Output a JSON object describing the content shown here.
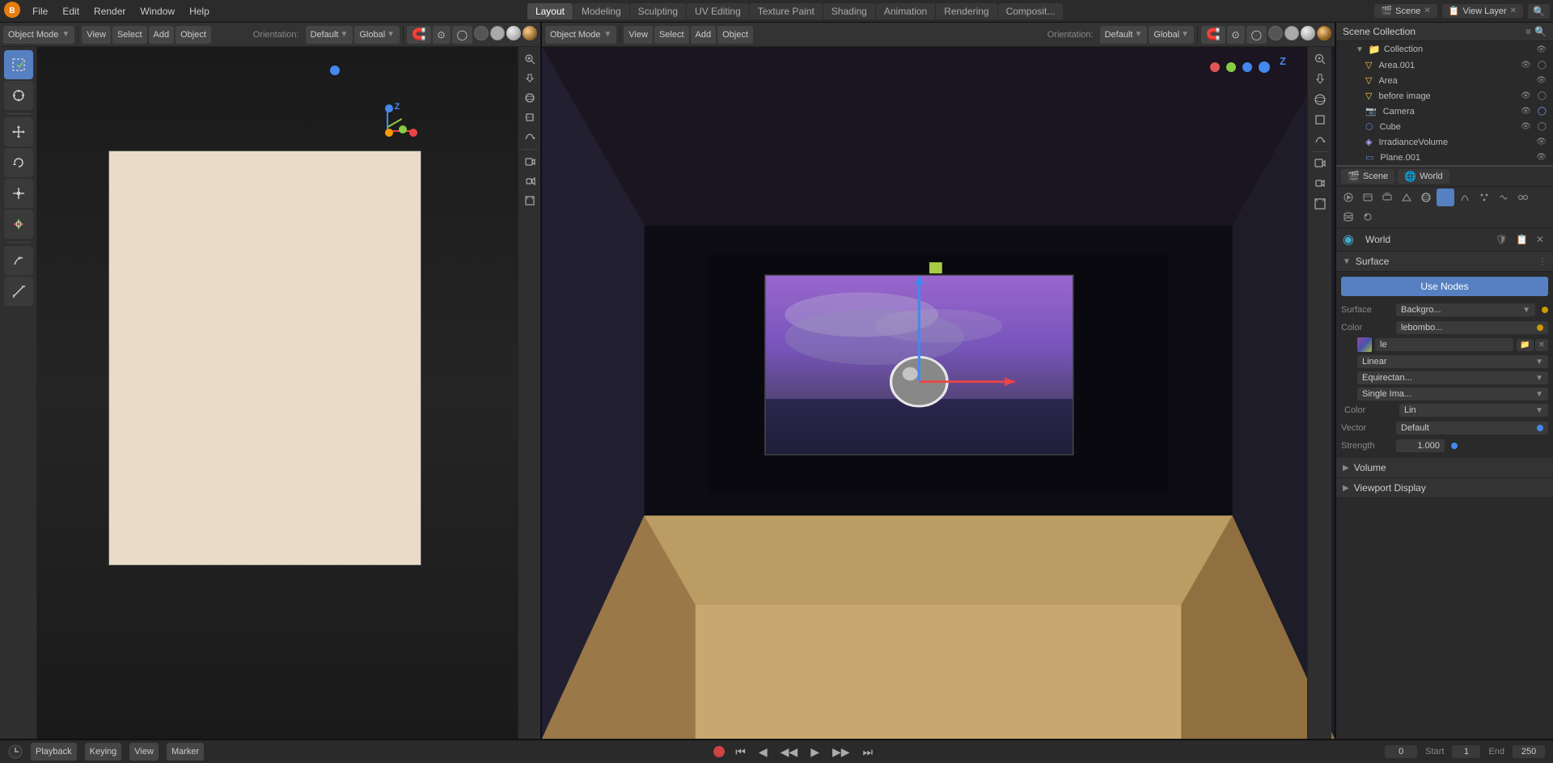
{
  "app": {
    "name": "Blender"
  },
  "top_menu": {
    "items": [
      "File",
      "Edit",
      "Render",
      "Window",
      "Help"
    ],
    "workspaces": [
      "Layout",
      "Modeling",
      "Sculpting",
      "UV Editing",
      "Texture Paint",
      "Shading",
      "Animation",
      "Rendering",
      "Composit..."
    ],
    "active_workspace": "Layout",
    "scene": "Scene",
    "view_layer": "View Layer",
    "scene_label": "Scene",
    "view_layer_label": "View Layer"
  },
  "left_viewport": {
    "mode": "Object Mode",
    "view_label": "View",
    "select_label": "Select",
    "add_label": "Add",
    "object_label": "Object",
    "orientation_label": "Orientation:",
    "orientation_value": "Default",
    "transform_label": "Global"
  },
  "right_viewport": {
    "mode": "Object Mode",
    "view_label": "View",
    "select_label": "Select",
    "add_label": "Add",
    "object_label": "Object",
    "orientation_label": "Orientation:",
    "orientation_value": "Default",
    "transform_label": "Global"
  },
  "outliner": {
    "title": "Scene Collection",
    "items": [
      {
        "name": "Collection",
        "type": "collection",
        "indent": 1,
        "expanded": true
      },
      {
        "name": "Area.001",
        "type": "light",
        "indent": 2
      },
      {
        "name": "Area",
        "type": "light",
        "indent": 2
      },
      {
        "name": "before image",
        "type": "object",
        "indent": 2
      },
      {
        "name": "Camera",
        "type": "camera",
        "indent": 2
      },
      {
        "name": "Cube",
        "type": "mesh",
        "indent": 2
      },
      {
        "name": "IrradianceVolume",
        "type": "object",
        "indent": 2
      },
      {
        "name": "Plane.001",
        "type": "mesh",
        "indent": 2
      }
    ]
  },
  "properties_panel": {
    "scene_label": "Scene",
    "world_label": "World",
    "world_name": "World",
    "surface_label": "Surface",
    "use_nodes_label": "Use Nodes",
    "surface_prop_label": "Surface",
    "surface_prop_value": "Backgro...",
    "color_label": "Color",
    "color_value": "lebombo...",
    "image_name": "le",
    "linear_label": "Linear",
    "equirect_label": "Equirectan...",
    "single_image_label": "Single Ima...",
    "color_lin_label": "Color",
    "color_lin_value": "Lin",
    "vector_label": "Vector",
    "vector_value": "Default",
    "strength_label": "Strength",
    "strength_value": "1.000",
    "volume_label": "Volume",
    "viewport_display_label": "Viewport Display"
  },
  "timeline": {
    "playback_label": "Playback",
    "keying_label": "Keying",
    "view_label": "View",
    "marker_label": "Marker",
    "frame_current": "0",
    "start_label": "Start",
    "start_value": "1",
    "end_label": "End",
    "end_value": "250"
  },
  "icons": {
    "arrow_right": "▶",
    "arrow_down": "▼",
    "eye": "👁",
    "close": "✕",
    "add": "+",
    "camera": "📷",
    "light": "💡",
    "mesh": "⬡",
    "world": "🌐",
    "object": "◆",
    "scene": "🎬",
    "check": "✓",
    "dot": "●",
    "gear": "⚙",
    "filter": "≡",
    "select_box": "⬜",
    "cursor": "⊕",
    "grab": "✋",
    "rotate": "↻",
    "scale": "⤡",
    "transform": "⤢",
    "annotate": "✏",
    "measure": "📐",
    "zoom_in": "+",
    "zoom_out": "−",
    "lock": "🔒",
    "sphere": "◉",
    "grid": "⊞"
  }
}
